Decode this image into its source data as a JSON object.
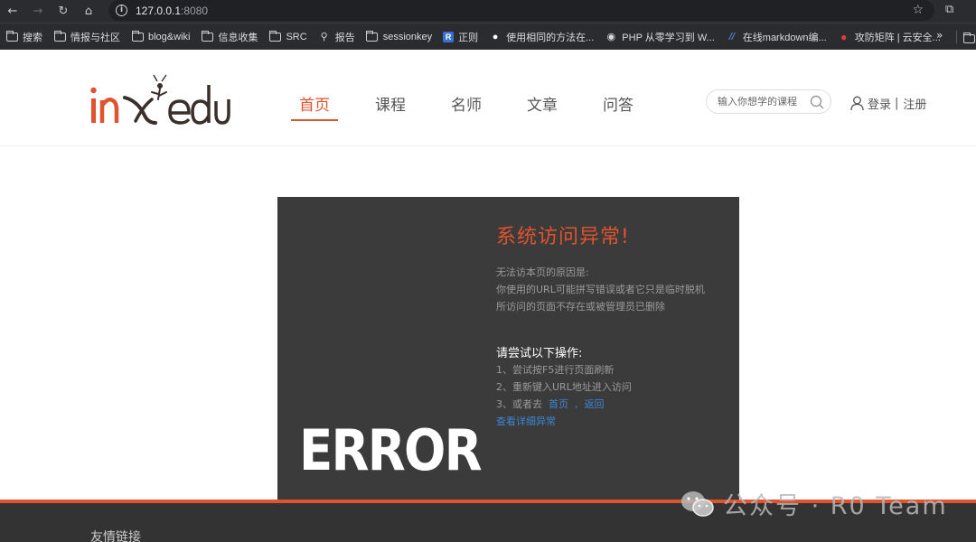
{
  "browser": {
    "url_host": "127.0.0.1",
    "url_port": ":8080",
    "bookmarks": [
      {
        "label": "搜索",
        "icon": "folder-icon"
      },
      {
        "label": "情报与社区",
        "icon": "folder-icon"
      },
      {
        "label": "blog&wiki",
        "icon": "folder-icon"
      },
      {
        "label": "信息收集",
        "icon": "folder-icon"
      },
      {
        "label": "SRC",
        "icon": "folder-icon"
      },
      {
        "label": "报告",
        "icon": "pin-icon"
      },
      {
        "label": "sessionkey",
        "icon": "folder-icon"
      },
      {
        "label": "正则",
        "icon": "r-icon"
      },
      {
        "label": "使用相同的方法在...",
        "icon": "fire-icon"
      },
      {
        "label": "PHP 从零学习到 W...",
        "icon": "github-icon"
      },
      {
        "label": "在线markdown编...",
        "icon": "markdown-icon"
      },
      {
        "label": "攻防矩阵 | 云安全...",
        "icon": "red-icon"
      }
    ],
    "more": "»"
  },
  "site": {
    "logo_text": "inxedu",
    "nav": [
      {
        "label": "首页",
        "active": true
      },
      {
        "label": "课程",
        "active": false
      },
      {
        "label": "名师",
        "active": false
      },
      {
        "label": "文章",
        "active": false
      },
      {
        "label": "问答",
        "active": false
      }
    ],
    "search_placeholder": "输入你想学的课程",
    "login": "登录",
    "separator": "|",
    "register": "注册"
  },
  "error": {
    "title": "系统访问异常!",
    "reason_title": "无法访本页的原因是:",
    "reason_1": "你使用的URL可能拼写错误或者它只是临时脱机",
    "reason_2": "所访问的页面不存在或被管理员已删除",
    "try_title": "请尝试以下操作:",
    "step_1": "1、尝试按F5进行页面刷新",
    "step_2": "2、重新键入URL地址进入访问",
    "step_3_prefix": "3、或者去",
    "step_3_home": "首页",
    "step_3_comma": ",",
    "step_3_back": "返回",
    "detail_link": "查看详细异常",
    "big_text": "ERROR"
  },
  "footer": {
    "title": "友情链接"
  },
  "watermark": {
    "text": "公众号 · R0 Team"
  },
  "colors": {
    "accent": "#e0532e",
    "link": "#3a86d6",
    "card_bg": "#3b3b3b"
  }
}
